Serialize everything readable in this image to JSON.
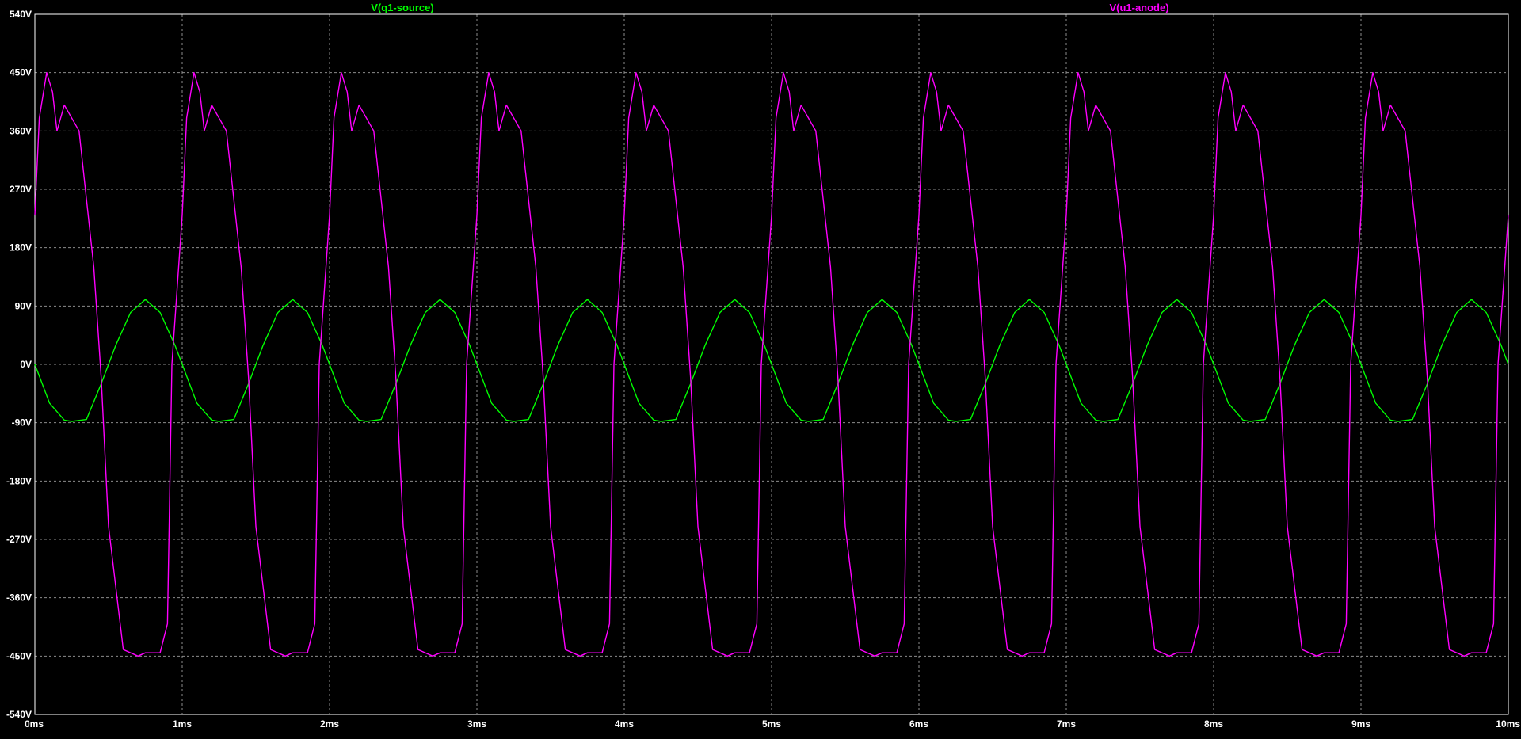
{
  "colors": {
    "background": "#000000",
    "grid": "#8c8c8c",
    "frame": "#ffffff",
    "tick_text": "#ffffff"
  },
  "chart_data": {
    "type": "line",
    "title": "",
    "xlabel": "",
    "ylabel": "",
    "xlim": [
      0,
      10
    ],
    "ylim": [
      -540,
      540
    ],
    "x_unit": "ms",
    "y_unit": "V",
    "grid": true,
    "legend_placement": "top",
    "x_ticks": [
      "0ms",
      "1ms",
      "2ms",
      "3ms",
      "4ms",
      "5ms",
      "6ms",
      "7ms",
      "8ms",
      "9ms",
      "10ms"
    ],
    "y_ticks": [
      "540V",
      "450V",
      "360V",
      "270V",
      "180V",
      "90V",
      "0V",
      "-90V",
      "-180V",
      "-270V",
      "-360V",
      "-450V",
      "-540V"
    ],
    "series": [
      {
        "name": "V(q1-source)",
        "color": "#00ff00",
        "period_ms": 1.0,
        "x": [
          0.0,
          0.1,
          0.2,
          0.25,
          0.35,
          0.45,
          0.55,
          0.65,
          0.75,
          0.85,
          0.95,
          1.0,
          1.1,
          1.2,
          1.25,
          1.35,
          1.45,
          1.55,
          1.65,
          1.75,
          1.85,
          1.95,
          2.0,
          2.1,
          2.2,
          2.25,
          2.35,
          2.45,
          2.55,
          2.65,
          2.75,
          2.85,
          2.95,
          3.0,
          3.1,
          3.2,
          3.25,
          3.35,
          3.45,
          3.55,
          3.65,
          3.75,
          3.85,
          3.95,
          4.0,
          4.1,
          4.2,
          4.25,
          4.35,
          4.45,
          4.55,
          4.65,
          4.75,
          4.85,
          4.95,
          5.0,
          5.1,
          5.2,
          5.25,
          5.35,
          5.45,
          5.55,
          5.65,
          5.75,
          5.85,
          5.95,
          6.0,
          6.1,
          6.2,
          6.25,
          6.35,
          6.45,
          6.55,
          6.65,
          6.75,
          6.85,
          6.95,
          7.0,
          7.1,
          7.2,
          7.25,
          7.35,
          7.45,
          7.55,
          7.65,
          7.75,
          7.85,
          7.95,
          8.0,
          8.1,
          8.2,
          8.25,
          8.35,
          8.45,
          8.55,
          8.65,
          8.75,
          8.85,
          8.95,
          9.0,
          9.1,
          9.2,
          9.25,
          9.35,
          9.45,
          9.55,
          9.65,
          9.75,
          9.85,
          9.95,
          10.0
        ],
        "y": [
          0,
          -60,
          -86,
          -88,
          -85,
          -30,
          30,
          80,
          100,
          80,
          30,
          0,
          -60,
          -86,
          -88,
          -85,
          -30,
          30,
          80,
          100,
          80,
          30,
          0,
          -60,
          -86,
          -88,
          -85,
          -30,
          30,
          80,
          100,
          80,
          30,
          0,
          -60,
          -86,
          -88,
          -85,
          -30,
          30,
          80,
          100,
          80,
          30,
          0,
          -60,
          -86,
          -88,
          -85,
          -30,
          30,
          80,
          100,
          80,
          30,
          0,
          -60,
          -86,
          -88,
          -85,
          -30,
          30,
          80,
          100,
          80,
          30,
          0,
          -60,
          -86,
          -88,
          -85,
          -30,
          30,
          80,
          100,
          80,
          30,
          0,
          -60,
          -86,
          -88,
          -85,
          -30,
          30,
          80,
          100,
          80,
          30,
          0,
          -60,
          -86,
          -88,
          -85,
          -30,
          30,
          80,
          100,
          80,
          30,
          0,
          -60,
          -86,
          -88,
          -85,
          -30,
          30,
          80,
          100,
          80,
          30,
          0
        ]
      },
      {
        "name": "V(u1-anode)",
        "color": "#ff00ff",
        "period_ms": 1.0,
        "x": [
          0.0,
          0.03,
          0.08,
          0.12,
          0.15,
          0.2,
          0.3,
          0.4,
          0.45,
          0.5,
          0.6,
          0.7,
          0.75,
          0.85,
          0.9,
          0.93,
          1.0,
          1.03,
          1.08,
          1.12,
          1.15,
          1.2,
          1.3,
          1.4,
          1.45,
          1.5,
          1.6,
          1.7,
          1.75,
          1.85,
          1.9,
          1.93,
          2.0,
          2.03,
          2.08,
          2.12,
          2.15,
          2.2,
          2.3,
          2.4,
          2.45,
          2.5,
          2.6,
          2.7,
          2.75,
          2.85,
          2.9,
          2.93,
          3.0,
          3.03,
          3.08,
          3.12,
          3.15,
          3.2,
          3.3,
          3.4,
          3.45,
          3.5,
          3.6,
          3.7,
          3.75,
          3.85,
          3.9,
          3.93,
          4.0,
          4.03,
          4.08,
          4.12,
          4.15,
          4.2,
          4.3,
          4.4,
          4.45,
          4.5,
          4.6,
          4.7,
          4.75,
          4.85,
          4.9,
          4.93,
          5.0,
          5.03,
          5.08,
          5.12,
          5.15,
          5.2,
          5.3,
          5.4,
          5.45,
          5.5,
          5.6,
          5.7,
          5.75,
          5.85,
          5.9,
          5.93,
          6.0,
          6.03,
          6.08,
          6.12,
          6.15,
          6.2,
          6.3,
          6.4,
          6.45,
          6.5,
          6.6,
          6.7,
          6.75,
          6.85,
          6.9,
          6.93,
          7.0,
          7.03,
          7.08,
          7.12,
          7.15,
          7.2,
          7.3,
          7.4,
          7.45,
          7.5,
          7.6,
          7.7,
          7.75,
          7.85,
          7.9,
          7.93,
          8.0,
          8.03,
          8.08,
          8.12,
          8.15,
          8.2,
          8.3,
          8.4,
          8.45,
          8.5,
          8.6,
          8.7,
          8.75,
          8.85,
          8.9,
          8.93,
          9.0,
          9.03,
          9.08,
          9.12,
          9.15,
          9.2,
          9.3,
          9.4,
          9.45,
          9.5,
          9.6,
          9.7,
          9.75,
          9.85,
          9.9,
          9.93,
          10.0
        ],
        "y": [
          230,
          380,
          450,
          420,
          360,
          400,
          360,
          150,
          -20,
          -250,
          -440,
          -450,
          -445,
          -445,
          -400,
          0,
          230,
          380,
          450,
          420,
          360,
          400,
          360,
          150,
          -20,
          -250,
          -440,
          -450,
          -445,
          -445,
          -400,
          0,
          230,
          380,
          450,
          420,
          360,
          400,
          360,
          150,
          -20,
          -250,
          -440,
          -450,
          -445,
          -445,
          -400,
          0,
          230,
          380,
          450,
          420,
          360,
          400,
          360,
          150,
          -20,
          -250,
          -440,
          -450,
          -445,
          -445,
          -400,
          0,
          230,
          380,
          450,
          420,
          360,
          400,
          360,
          150,
          -20,
          -250,
          -440,
          -450,
          -445,
          -445,
          -400,
          0,
          230,
          380,
          450,
          420,
          360,
          400,
          360,
          150,
          -20,
          -250,
          -440,
          -450,
          -445,
          -445,
          -400,
          0,
          230,
          380,
          450,
          420,
          360,
          400,
          360,
          150,
          -20,
          -250,
          -440,
          -450,
          -445,
          -445,
          -400,
          0,
          230,
          380,
          450,
          420,
          360,
          400,
          360,
          150,
          -20,
          -250,
          -440,
          -450,
          -445,
          -445,
          -400,
          0,
          230,
          380,
          450,
          420,
          360,
          400,
          360,
          150,
          -20,
          -250,
          -440,
          -450,
          -445,
          -445,
          -400,
          0,
          230,
          380,
          450,
          420,
          360,
          400,
          360,
          150,
          -20,
          -250,
          -440,
          -450,
          -445,
          -445,
          -400,
          0,
          230
        ]
      }
    ]
  }
}
